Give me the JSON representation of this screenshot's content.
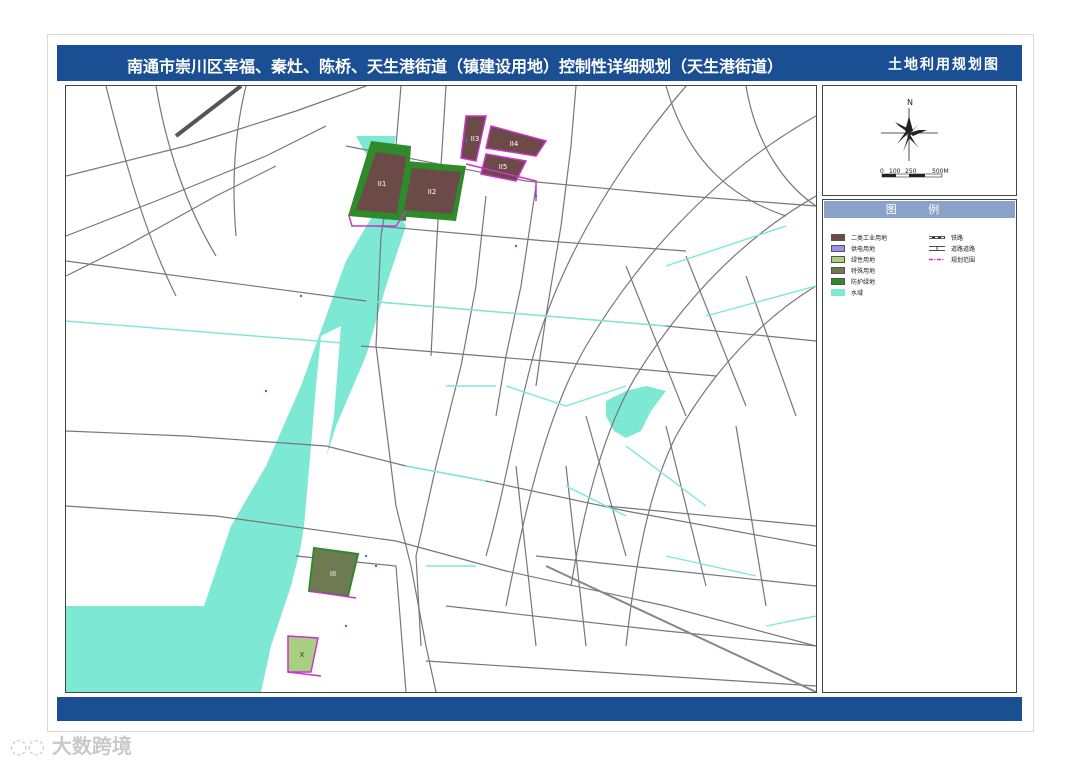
{
  "header": {
    "title": "南通市崇川区幸福、秦灶、陈桥、天生港街道（镇建设用地）控制性详细规划（天生港街道）",
    "subtitle": "土地利用规划图"
  },
  "compass": {
    "north": "N",
    "scale_labels": [
      "0",
      "100",
      "250",
      "500M"
    ]
  },
  "legend": {
    "title": "图 例",
    "items_left": [
      {
        "label": "二类工业用地",
        "color": "#6b4a48"
      },
      {
        "label": "供电用地",
        "color": "#9b8ff0"
      },
      {
        "label": "绿性用地",
        "color": "#a8d080"
      },
      {
        "label": "特殊用地",
        "color": "#6e7a52"
      },
      {
        "label": "防护绿地",
        "color": "#2f8a2a"
      },
      {
        "label": "水域",
        "color": "#7de8d4"
      }
    ],
    "items_right": [
      {
        "label": "铁路",
        "style": "rail"
      },
      {
        "label": "道路道路",
        "style": "road"
      },
      {
        "label": "规划范围",
        "style": "boundary"
      }
    ]
  },
  "parcels": [
    {
      "code": "II1"
    },
    {
      "code": "II2"
    },
    {
      "code": "II3"
    },
    {
      "code": "II4"
    },
    {
      "code": "II5"
    },
    {
      "code": "III"
    },
    {
      "code": "X"
    }
  ],
  "colors": {
    "title_bar": "#1b4f94",
    "water": "#7de8d4",
    "road_line": "#777777",
    "industrial": "#6b4a48",
    "green_buffer": "#2f8a2a",
    "boundary": "#cc33cc"
  },
  "watermark": "大数跨境"
}
